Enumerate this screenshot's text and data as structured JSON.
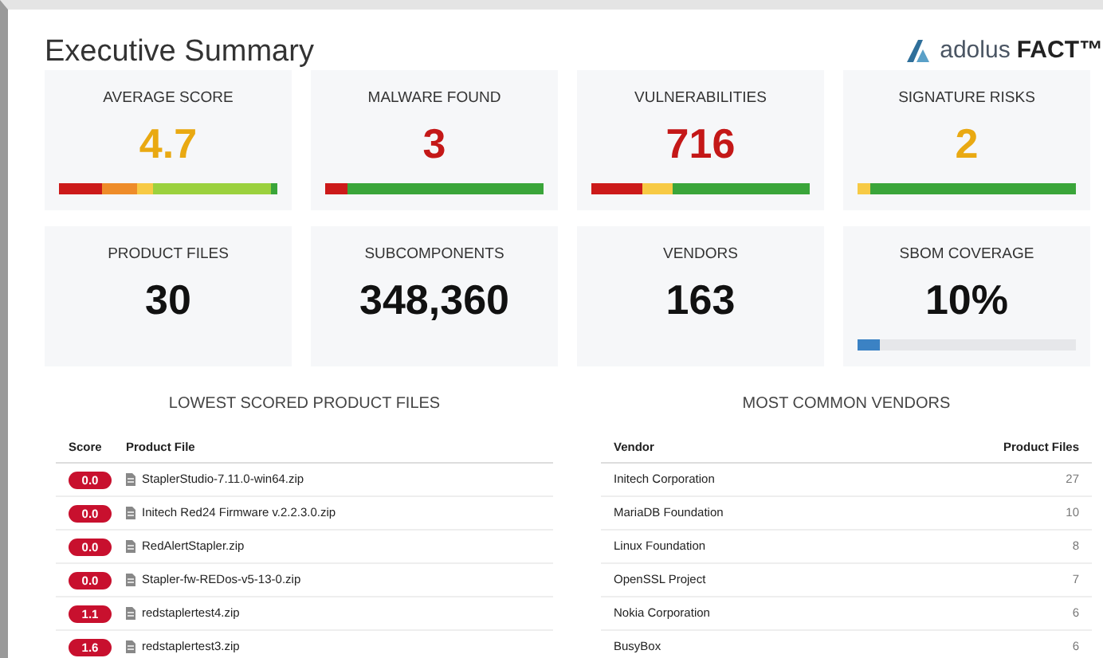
{
  "header": {
    "title": "Executive Summary",
    "logo": {
      "name": "adolus",
      "suffix": "FACT™"
    }
  },
  "metrics": [
    {
      "label": "AVERAGE SCORE",
      "value": "4.7",
      "color": "#e9a912",
      "kind": "segments",
      "segments": [
        {
          "color": "#cc1a1a"
        },
        {
          "color": "#ee8c2a"
        },
        {
          "color": "#f7ca45"
        },
        {
          "color": "#9bd13e"
        },
        {
          "color": "#3aa53a"
        }
      ]
    },
    {
      "label": "MALWARE FOUND",
      "value": "3",
      "color": "#c41818",
      "kind": "segments",
      "segments": [
        {
          "color": "#cc1a1a"
        },
        {
          "color": "#3aa53a"
        }
      ]
    },
    {
      "label": "VULNERABILITIES",
      "value": "716",
      "color": "#c41818",
      "kind": "segments",
      "segments": [
        {
          "color": "#cc1a1a"
        },
        {
          "color": "#f7ca45"
        },
        {
          "color": "#3aa53a"
        }
      ]
    },
    {
      "label": "SIGNATURE RISKS",
      "value": "2",
      "color": "#e9a912",
      "kind": "segments",
      "segments": [
        {
          "color": "#f7ca45"
        },
        {
          "color": "#3aa53a"
        }
      ]
    },
    {
      "label": "PRODUCT FILES",
      "value": "30",
      "color": "#111111",
      "kind": "plain"
    },
    {
      "label": "SUBCOMPONENTS",
      "value": "348,360",
      "color": "#111111",
      "kind": "plain"
    },
    {
      "label": "VENDORS",
      "value": "163",
      "color": "#111111",
      "kind": "plain"
    },
    {
      "label": "SBOM COVERAGE",
      "value": "10%",
      "color": "#111111",
      "kind": "progress",
      "level": 0.1
    }
  ],
  "lowest_scored": {
    "title": "LOWEST SCORED PRODUCT FILES",
    "columns": [
      "Score",
      "Product File"
    ],
    "rows": [
      {
        "score": "0.0",
        "file": "StaplerStudio-7.11.0-win64.zip"
      },
      {
        "score": "0.0",
        "file": "Initech Red24 Firmware v.2.2.3.0.zip"
      },
      {
        "score": "0.0",
        "file": "RedAlertStapler.zip"
      },
      {
        "score": "0.0",
        "file": "Stapler-fw-REDos-v5-13-0.zip"
      },
      {
        "score": "1.1",
        "file": "redstaplertest4.zip"
      },
      {
        "score": "1.6",
        "file": "redstaplertest3.zip"
      }
    ]
  },
  "common_vendors": {
    "title": "MOST COMMON VENDORS",
    "columns": [
      "Vendor",
      "Product Files"
    ],
    "rows": [
      {
        "vendor": "Initech Corporation",
        "count": "27"
      },
      {
        "vendor": "MariaDB Foundation",
        "count": "10"
      },
      {
        "vendor": "Linux Foundation",
        "count": "8"
      },
      {
        "vendor": "OpenSSL Project",
        "count": "7"
      },
      {
        "vendor": "Nokia Corporation",
        "count": "6"
      },
      {
        "vendor": "BusyBox",
        "count": "6"
      }
    ]
  }
}
